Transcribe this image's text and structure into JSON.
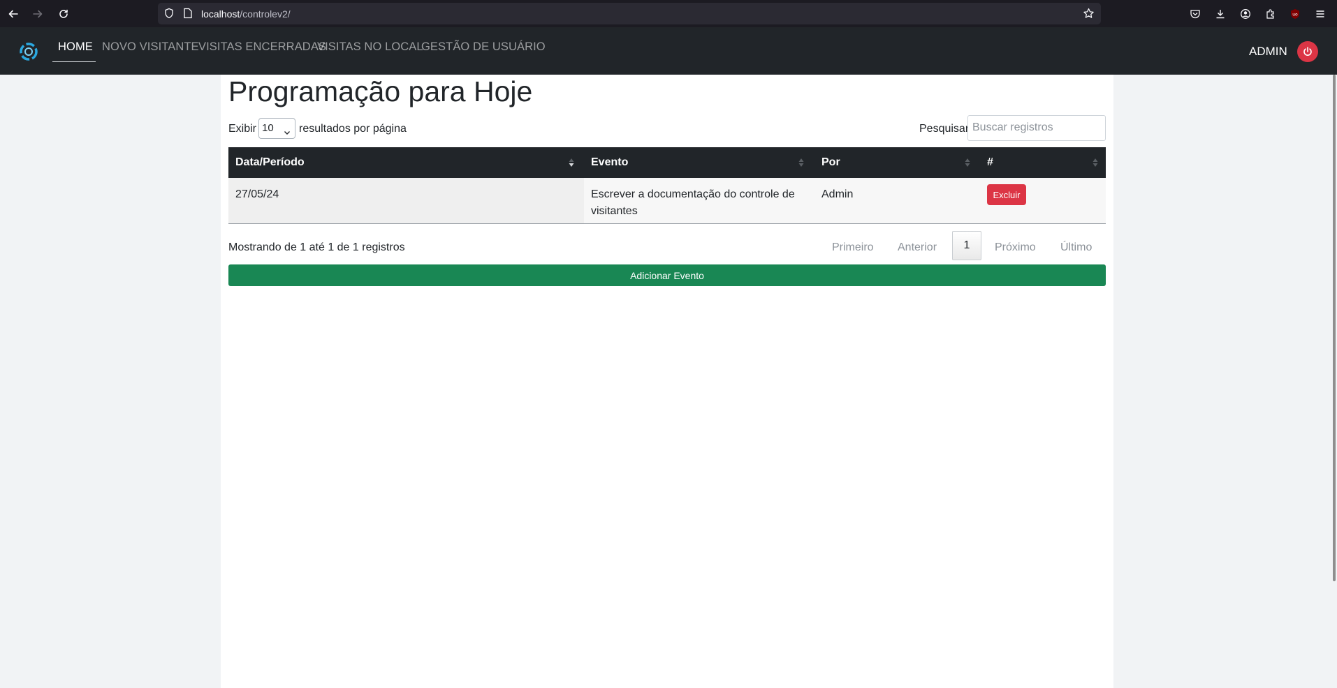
{
  "browser": {
    "url_host": "localhost",
    "url_path": "/controlev2/"
  },
  "navbar": {
    "items": [
      {
        "label": "HOME",
        "active": true
      },
      {
        "label": "NOVO VISITANTE",
        "active": false
      },
      {
        "label": "VISITAS ENCERRADAS",
        "active": false
      },
      {
        "label": "VISITAS NO LOCAL",
        "active": false
      },
      {
        "label": "GESTÃO DE USUÁRIO",
        "active": false
      }
    ],
    "user_label": "ADMIN"
  },
  "page": {
    "title": "Programação para Hoje"
  },
  "table_controls": {
    "length_prefix": "Exibir",
    "length_value": "10",
    "length_suffix": "resultados por página",
    "search_label": "Pesquisar",
    "search_placeholder": "Buscar registros"
  },
  "table": {
    "columns": [
      "Data/Período",
      "Evento",
      "Por",
      "#"
    ],
    "rows": [
      {
        "date": "27/05/24",
        "event": "Escrever a documentação do controle de visitantes",
        "by": "Admin",
        "action": "Excluir"
      }
    ]
  },
  "footer": {
    "info": "Mostrando de 1 até 1 de 1 registros",
    "pagination": {
      "first": "Primeiro",
      "previous": "Anterior",
      "current": "1",
      "next": "Próximo",
      "last": "Último"
    }
  },
  "add_button_label": "Adicionar Evento",
  "colors": {
    "navbar": "#212529",
    "danger": "#dc3545",
    "success": "#198754"
  }
}
